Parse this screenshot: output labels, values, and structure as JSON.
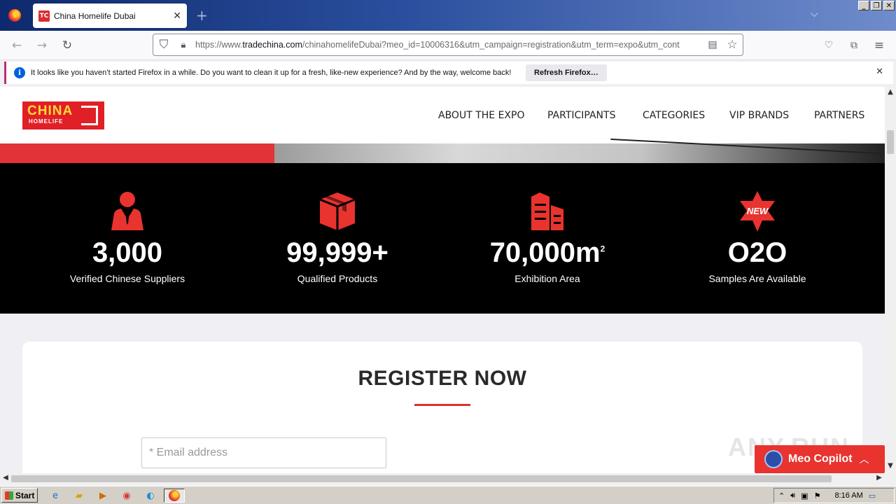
{
  "browser": {
    "tab_title": "China Homelife Dubai",
    "tab_favicon": "TC",
    "url_prefix": "https://www.",
    "url_domain": "tradechina.com",
    "url_rest": "/chinahomelifeDubai?meo_id=10006316&utm_campaign=registration&utm_term=expo&utm_cont",
    "notification_text": "It looks like you haven’t started Firefox in a while. Do you want to clean it up for a fresh, like-new experience? And by the way, welcome back!",
    "refresh_label": "Refresh Firefox…"
  },
  "site": {
    "logo_top": "CHINA",
    "logo_bottom": "HOMELIFE",
    "menu": [
      "ABOUT THE EXPO",
      "PARTICIPANTS",
      "CATEGORIES",
      "VIP BRANDS",
      "PARTNERS"
    ],
    "stats": [
      {
        "icon": "supplier-icon",
        "value": "3,000",
        "unit": "",
        "label": "Verified Chinese Suppliers"
      },
      {
        "icon": "box-icon",
        "value": "99,999+",
        "unit": "",
        "label": "Qualified Products"
      },
      {
        "icon": "building-icon",
        "value": "70,000m",
        "unit": "2",
        "label": "Exhibition Area"
      },
      {
        "icon": "new-badge-icon",
        "value": "O2O",
        "unit": "",
        "label": "Samples Are Available",
        "badge": "NEW"
      }
    ],
    "register_title": "REGISTER NOW",
    "email_placeholder": "* Email address",
    "copilot_label": "Meo Copilot",
    "watermark": "ANY.RUN"
  },
  "taskbar": {
    "start": "Start",
    "clock": "8:16 AM"
  },
  "colors": {
    "brand_red": "#e11f26",
    "stat_icon_red": "#e8332f"
  }
}
